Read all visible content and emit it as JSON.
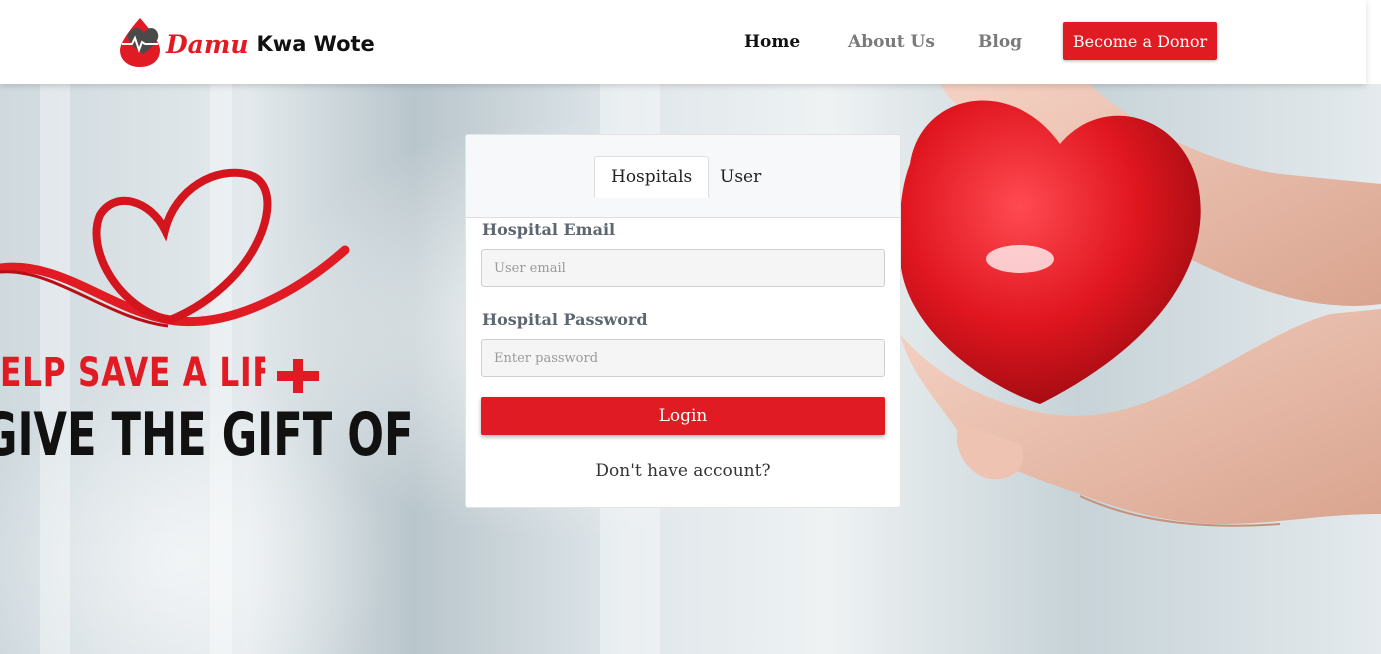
{
  "brand": {
    "script_name": "Damu",
    "name_rest": "Kwa Wote",
    "accent_color": "#e01b24"
  },
  "nav": {
    "home": "Home",
    "about": "About Us",
    "blog": "Blog",
    "cta": "Become a Donor"
  },
  "hero": {
    "line1": "ELP SAVE A LIFE",
    "line2": "GIVE THE GIFT OF BLO",
    "icons": [
      "ribbon-heart-icon",
      "red-cross-icon",
      "heart-in-hands-image"
    ]
  },
  "login": {
    "tabs": [
      {
        "label": "Hospitals",
        "active": true
      },
      {
        "label": "User",
        "active": false
      }
    ],
    "email_label": "Hospital Email",
    "email_placeholder": "User email",
    "password_label": "Hospital Password",
    "password_placeholder": "Enter password",
    "submit_label": "Login",
    "no_account": "Don't have account?"
  }
}
